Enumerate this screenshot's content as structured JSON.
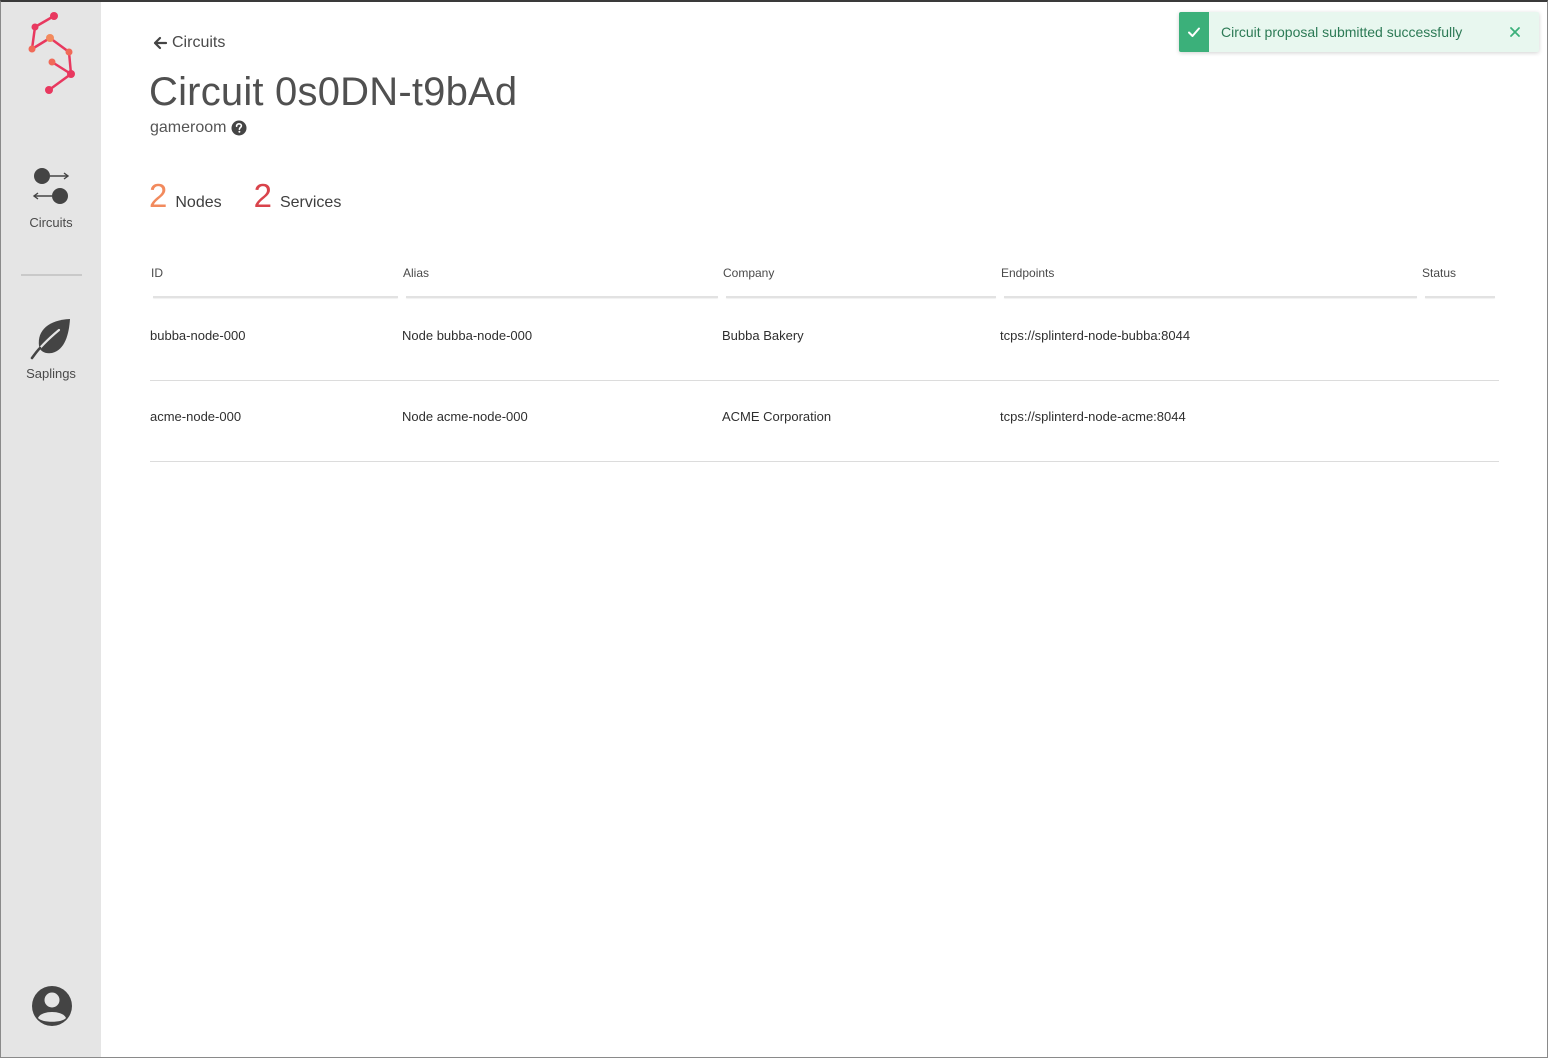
{
  "sidebar": {
    "logo_icon": "splinter-logo-icon",
    "items": [
      {
        "label": "Circuits",
        "icon": "circuits-icon"
      },
      {
        "label": "Saplings",
        "icon": "leaf-icon"
      }
    ],
    "profile_icon": "account-circle-icon"
  },
  "back_link": {
    "label": "Circuits",
    "icon": "arrow-left-icon"
  },
  "page": {
    "title": "Circuit 0s0DN-t9bAd",
    "subtitle": "gameroom",
    "help_icon": "question-circle-icon"
  },
  "stats": {
    "nodes": {
      "count": "2",
      "label": "Nodes"
    },
    "services": {
      "count": "2",
      "label": "Services"
    }
  },
  "table": {
    "columns": [
      "ID",
      "Alias",
      "Company",
      "Endpoints",
      "Status"
    ],
    "rows": [
      {
        "id": "bubba-node-000",
        "alias": "Node bubba-node-000",
        "company": "Bubba Bakery",
        "endpoints": "tcps://splinterd-node-bubba:8044",
        "status": ""
      },
      {
        "id": "acme-node-000",
        "alias": "Node acme-node-000",
        "company": "ACME Corporation",
        "endpoints": "tcps://splinterd-node-acme:8044",
        "status": ""
      }
    ]
  },
  "toast": {
    "message": "Circuit proposal submitted successfully",
    "icon": "check-icon",
    "close_icon": "close-icon"
  },
  "colors": {
    "sidebar_bg": "#e5e5e5",
    "nodes_accent": "#f28a5d",
    "services_accent": "#d9434b",
    "toast_accent": "#3bb07a",
    "toast_bg": "#e8f7ef"
  }
}
